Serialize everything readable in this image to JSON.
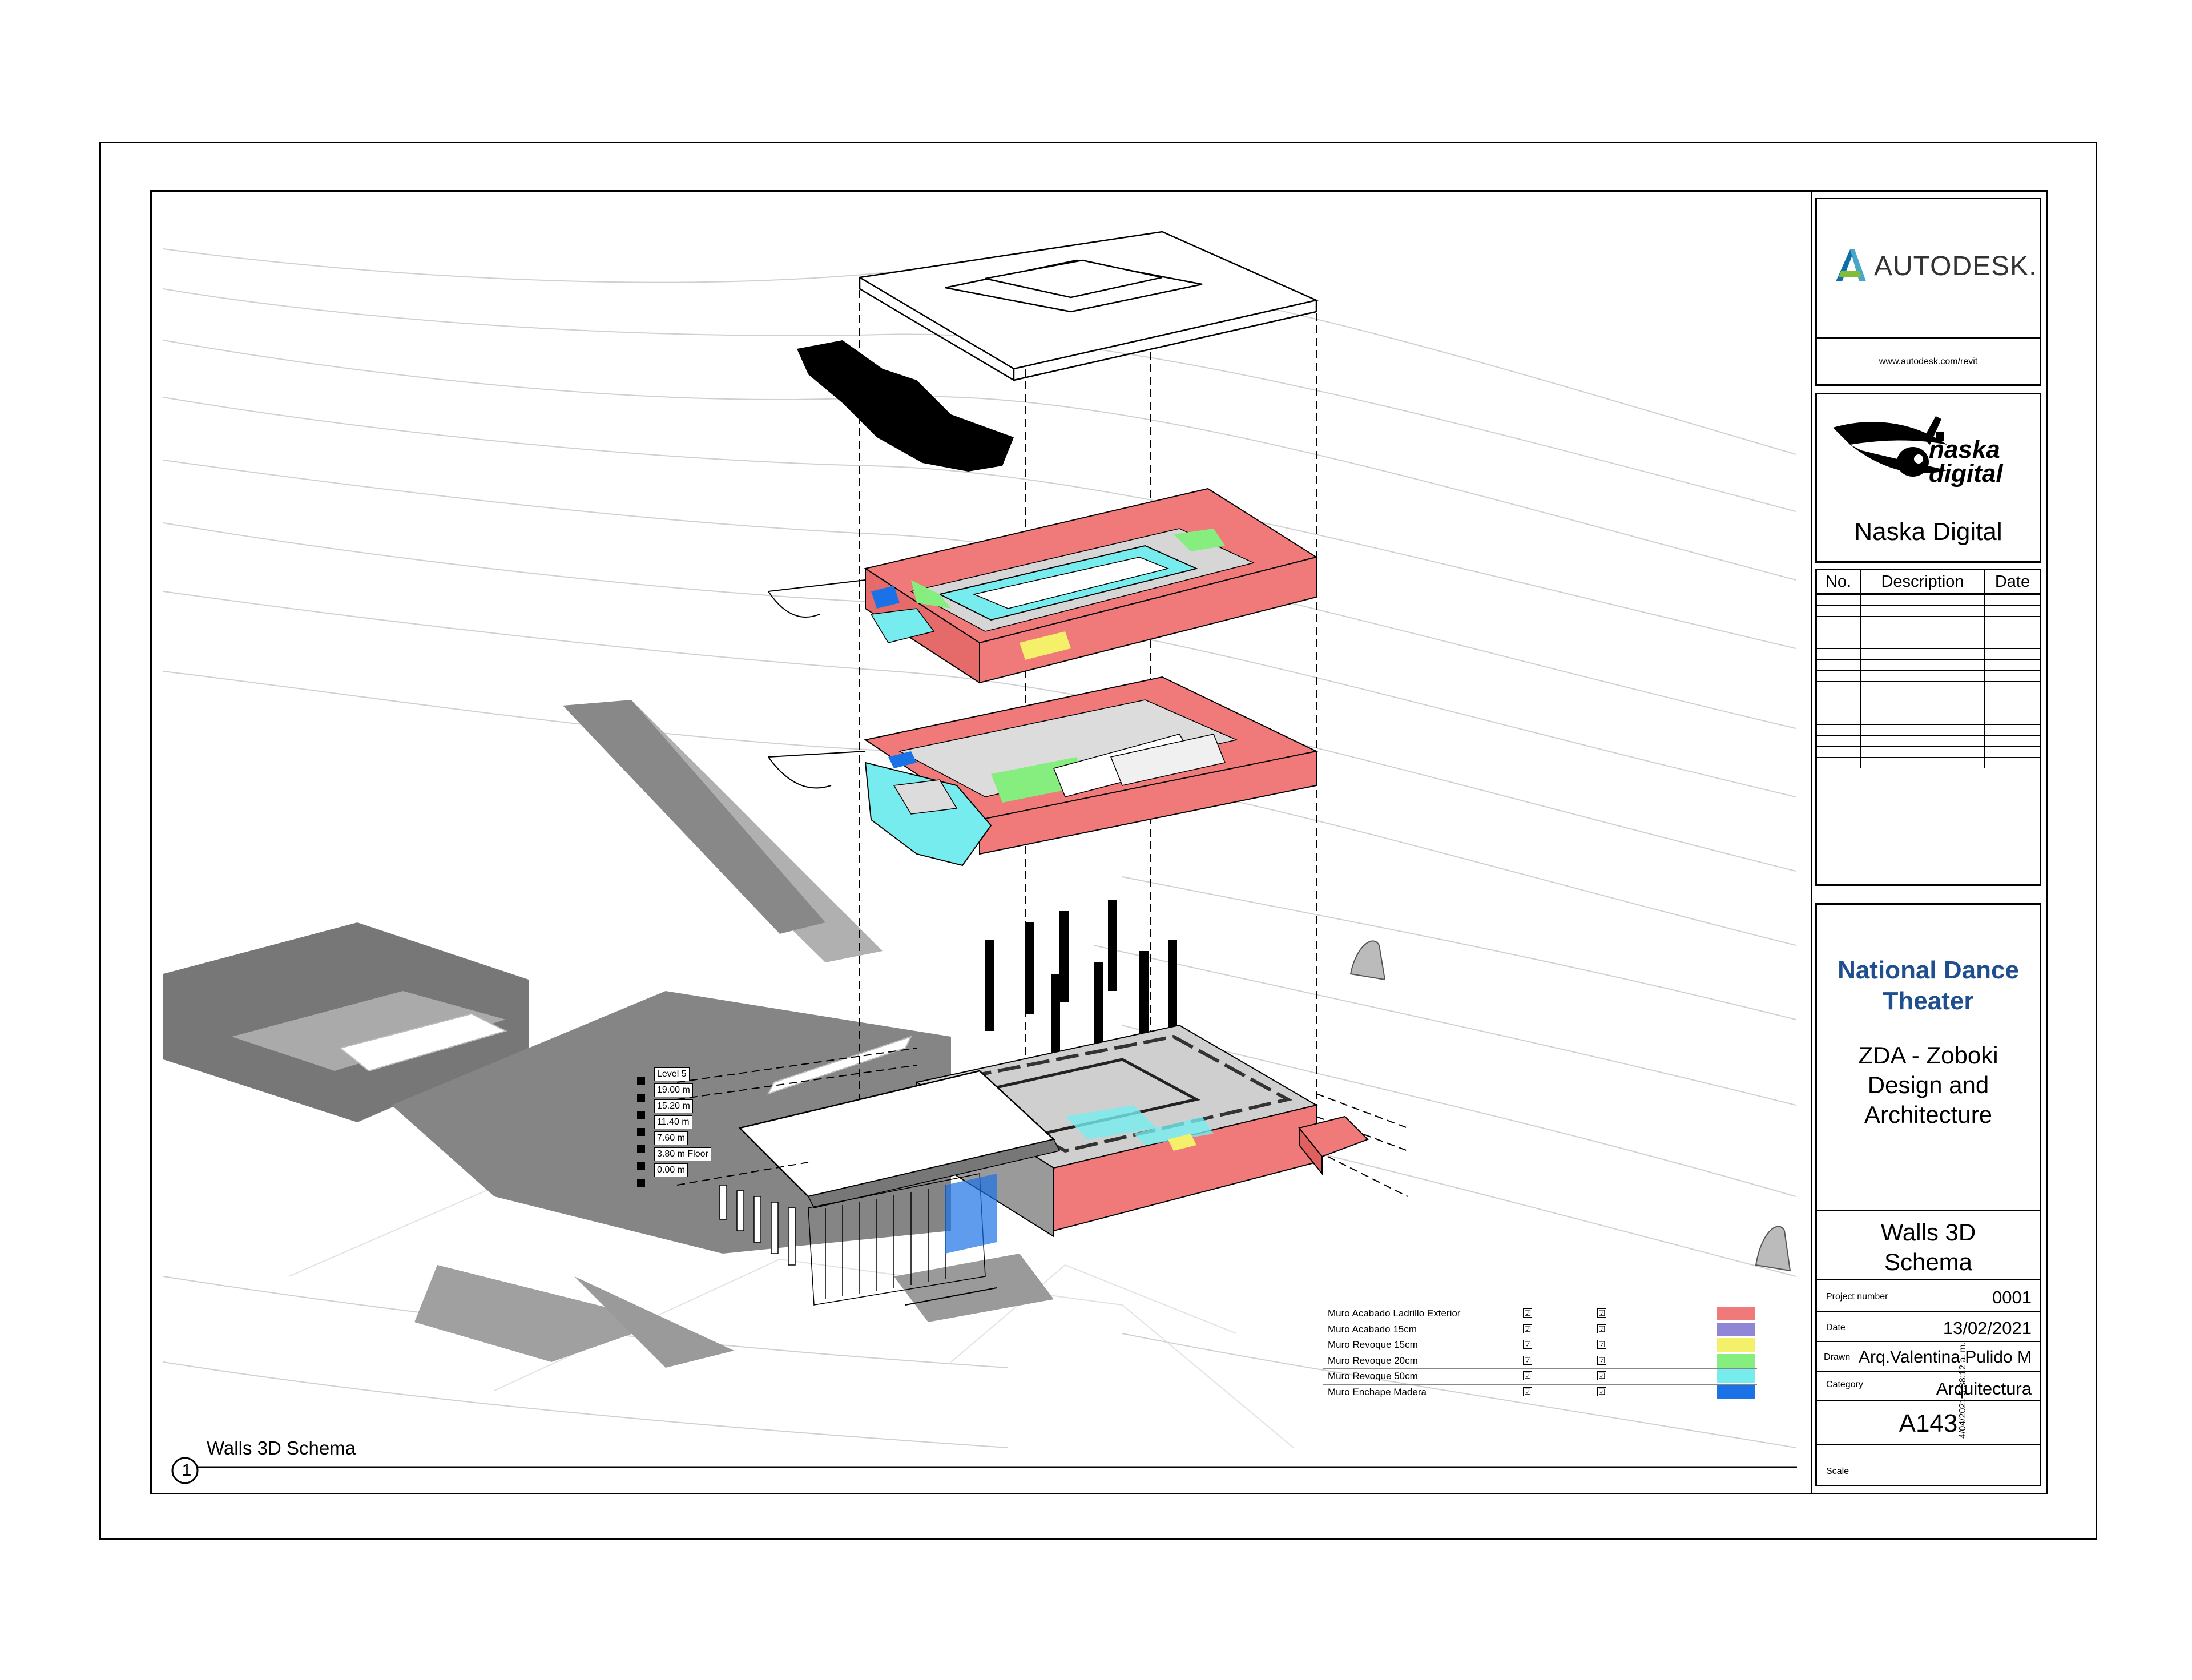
{
  "view": {
    "number": "1",
    "title": "Walls 3D Schema",
    "levels": [
      "Level 5",
      "19.00 m",
      "15.20 m",
      "11.40 m",
      "7.60 m",
      "3.80 m Floor",
      "0.00 m"
    ]
  },
  "legend": {
    "rows": [
      {
        "name": "Muro Acabado Ladrillo Exterior",
        "check1": "☑",
        "check2": "☑",
        "color": "#f07a7a"
      },
      {
        "name": "Muro Acabado 15cm",
        "check1": "☑",
        "check2": "☑",
        "color": "#8f86d6"
      },
      {
        "name": "Muro Revoque 15cm",
        "check1": "☑",
        "check2": "☑",
        "color": "#f5f06a"
      },
      {
        "name": "Muro Revoque 20cm",
        "check1": "☑",
        "check2": "☑",
        "color": "#86ee7e"
      },
      {
        "name": "Muro Revoque 50cm",
        "check1": "☑",
        "check2": "☑",
        "color": "#76ecee"
      },
      {
        "name": "Muro Enchape Madera",
        "check1": "☑",
        "check2": "☑",
        "color": "#1b72e6"
      }
    ]
  },
  "title_block": {
    "brand": "AUTODESK",
    "brand_mark": "AUTODESK.",
    "url": "www.autodesk.com/revit",
    "client_logo_top": "naska",
    "client_logo_bottom": "digital",
    "client_name": "Naska Digital",
    "revisions": {
      "headers": [
        "No.",
        "Description",
        "Date"
      ],
      "rows": 16
    },
    "project_name": "National Dance Theater",
    "firm": "ZDA - Zoboki Design and Architecture",
    "sheet_name": "Walls 3D Schema",
    "fields": [
      {
        "label": "Project number",
        "value": "0001"
      },
      {
        "label": "Date",
        "value": "13/02/2021"
      },
      {
        "label": "Drawn",
        "value": "Arq.Valentina Pulido M"
      },
      {
        "label": "Category",
        "value": "Arquitectura"
      }
    ],
    "sheet_number": "A143",
    "scale_label": "Scale",
    "print_stamp": "4/04/2021 5:38:12 a. m."
  },
  "colors": {
    "brick": "#f07a7a",
    "cyan": "#76ecee",
    "green": "#86ee7e",
    "yellow": "#f5f06a",
    "blue": "#1b72e6",
    "violet": "#8f86d6",
    "project_blue": "#1f4f8f"
  }
}
